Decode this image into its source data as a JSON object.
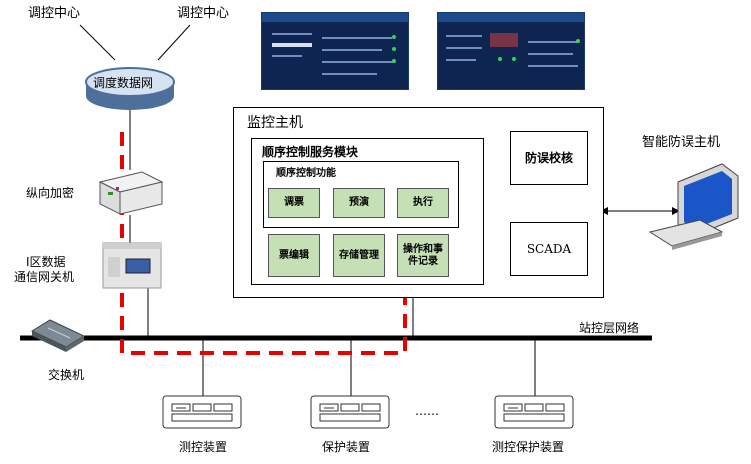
{
  "colors": {
    "module_fill": "#c5e0b4",
    "redundant_path": "#e60000",
    "network_line": "#000000",
    "screen_bg": "#0d2550"
  },
  "dispatch": {
    "center_left": "调控中心",
    "center_right": "调控中心",
    "network": "调度数据网"
  },
  "devices": {
    "encryption": "纵向加密",
    "gateway_line1": "I区数据",
    "gateway_line2": "通信网关机",
    "switch": "交换机",
    "anti_misoperation_host": "智能防误主机"
  },
  "monitor_host": {
    "title": "监控主机",
    "module_title": "顺序控制服务模块",
    "function_title": "顺序控制功能",
    "buttons": {
      "retrieve": "调票",
      "preview": "预演",
      "execute": "执行"
    },
    "modules": {
      "ticket_edit": "票编辑",
      "storage": "存储管理",
      "log": "操作和事件记录"
    },
    "anti_check": "防误校核",
    "scada": "SCADA"
  },
  "network": {
    "station_label": "站控层网络"
  },
  "bottom_devices": {
    "measure_control": "测控装置",
    "protection": "保护装置",
    "ellipsis": "……",
    "measure_protection": "测控保护装置"
  },
  "screens": {
    "left_icon": "screen-left-icon",
    "right_icon": "screen-right-icon"
  }
}
